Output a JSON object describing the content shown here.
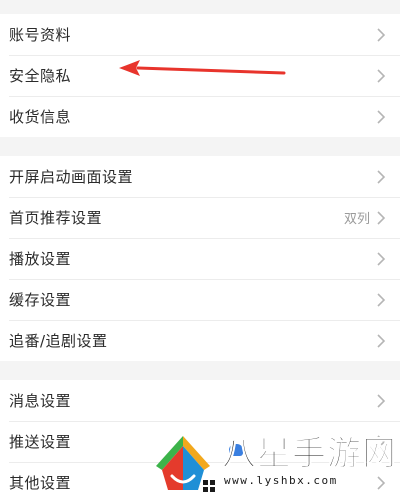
{
  "groups": [
    {
      "items": [
        {
          "label": "账号资料"
        },
        {
          "label": "安全隐私"
        },
        {
          "label": "收货信息"
        }
      ]
    },
    {
      "items": [
        {
          "label": "开屏启动画面设置"
        },
        {
          "label": "首页推荐设置",
          "value": "双列"
        },
        {
          "label": "播放设置"
        },
        {
          "label": "缓存设置"
        },
        {
          "label": "追番/追剧设置"
        }
      ]
    },
    {
      "items": [
        {
          "label": "消息设置"
        },
        {
          "label": "推送设置"
        },
        {
          "label": "其他设置"
        }
      ]
    }
  ],
  "annotation": {
    "icon": "red-arrow-icon",
    "color": "#e8342c"
  },
  "watermark": {
    "title": "八星手游网",
    "url": "www.lyshbx.com"
  },
  "colors": {
    "chevron": "#b5b5b5",
    "separator": "#f4f4f4"
  }
}
